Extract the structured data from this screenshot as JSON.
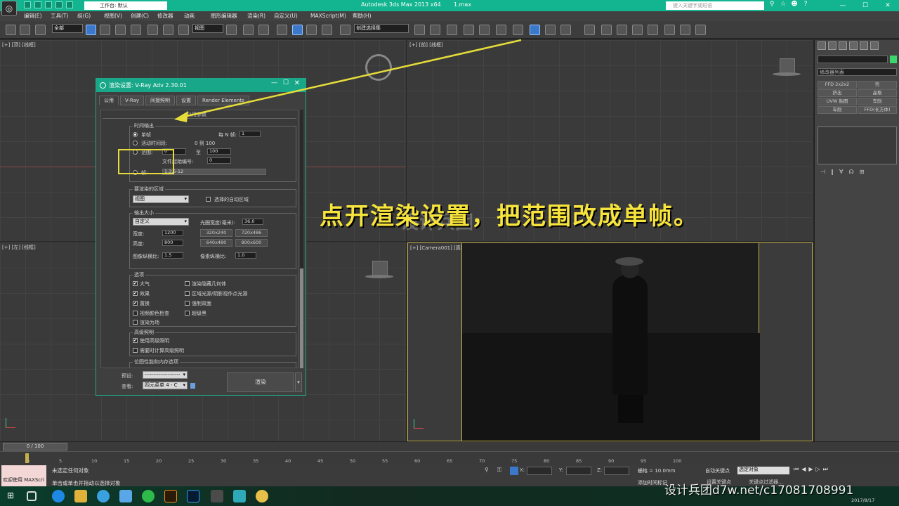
{
  "titlebar": {
    "workspace": "工作台: 默认",
    "app_title": "Autodesk 3ds Max  2013 x64",
    "file_name": "1.max",
    "search_placeholder": "键入关键字或短语",
    "minimize": "—",
    "maximize": "☐",
    "close": "✕",
    "logo": "◎"
  },
  "menu": [
    "编辑(E)",
    "工具(T)",
    "组(G)",
    "视图(V)",
    "创建(C)",
    "修改器",
    "动画",
    "图形编辑器",
    "渲染(R)",
    "自定义(U)",
    "MAXScript(M)",
    "帮助(H)"
  ],
  "toolbar": {
    "selection_filter": "全部",
    "ref_coord": "视图",
    "named_selection": "创建选择集"
  },
  "viewports": {
    "top_left_label": "[+] [顶] [线框]",
    "top_right_label": "[+] [前] [线框]",
    "bottom_left_label": "[+] [左] [线框]",
    "bottom_right_label": "[+] [Camera001] [真实]"
  },
  "overlay": {
    "instruction": "点开渲染设置，把范围改成单帧。",
    "watermark": "设计兵团"
  },
  "dialog": {
    "title": "渲染设置: V-Ray Adv 2.30.01",
    "tabs": [
      "公用",
      "V-Ray",
      "间接照明",
      "设置",
      "Render Elements"
    ],
    "rollout_title": "公用参数",
    "time_output": {
      "group_title": "时间输出",
      "single": "单帧",
      "every_nth_label": "每 N 帧:",
      "every_nth_value": "1",
      "active_segment": "活动时间段:",
      "active_range": "0 到 100",
      "range": "范围:",
      "range_from": "0",
      "range_to_label": "至",
      "range_to": "100",
      "file_start_label": "文件起始编号:",
      "file_start_value": "0",
      "frames": "帧:",
      "frames_value": "1,3,5-12"
    },
    "render_area": {
      "group_title": "要渲染的区域",
      "area_value": "视图",
      "auto_region": "选择的自动区域"
    },
    "output_size": {
      "group_title": "输出大小",
      "preset": "自定义",
      "aperture_label": "光圈宽度(毫米):",
      "aperture_value": "36.0",
      "width_label": "宽度:",
      "width_value": "1200",
      "height_label": "高度:",
      "height_value": "800",
      "presets": [
        "320x240",
        "720x486",
        "640x480",
        "800x600"
      ],
      "image_aspect_label": "图像纵横比:",
      "image_aspect_value": "1.5",
      "pixel_aspect_label": "像素纵横比:",
      "pixel_aspect_value": "1.0"
    },
    "options": {
      "group_title": "选项",
      "items": [
        {
          "label": "大气",
          "checked": "✔"
        },
        {
          "label": "渲染隐藏几何体",
          "checked": ""
        },
        {
          "label": "效果",
          "checked": "✔"
        },
        {
          "label": "区域光源/阴影视作点光源",
          "checked": ""
        },
        {
          "label": "置换",
          "checked": "✔"
        },
        {
          "label": "强制双面",
          "checked": ""
        },
        {
          "label": "视频颜色检查",
          "checked": ""
        },
        {
          "label": "超级黑",
          "checked": ""
        },
        {
          "label": "渲染为场",
          "checked": ""
        }
      ]
    },
    "advanced_lighting": {
      "group_title": "高级照明",
      "use": "使用高级照明",
      "use_checked": "✔",
      "compute": "需要时计算高级照明",
      "compute_checked": ""
    },
    "bitmap_group_title": "位图性能和内存选项",
    "preset_label": "预设:",
    "preset_value": "--------------------",
    "view_label": "查看:",
    "view_value": "四元菜单 4 - C",
    "render_button": "渲染",
    "render_dd": "▾"
  },
  "command_panel": {
    "modifier_list": "修改器列表",
    "buttons": [
      "FFD 2x2x2",
      "壳",
      "挤出",
      "晶格",
      "UVW 贴图",
      "车削",
      "车削",
      "FFD(长方体)"
    ],
    "stack_icons": [
      "⊣",
      "‖",
      "∀",
      "☊",
      "⊞"
    ]
  },
  "timeline": {
    "slider": "0 / 100",
    "ticks": [
      "0",
      "5",
      "10",
      "15",
      "20",
      "25",
      "30",
      "35",
      "40",
      "45",
      "50",
      "55",
      "60",
      "65",
      "70",
      "75",
      "80",
      "85",
      "90",
      "95",
      "100"
    ]
  },
  "status": {
    "maxscript": "欢迎使用 MAXScri",
    "line1": "未选定任何对象",
    "line2": "单击或单击并拖动以选择对象",
    "x_label": "X:",
    "y_label": "Y:",
    "z_label": "Z:",
    "grid": "栅格 = 10.0mm",
    "add_time_tag": "添加时间标记",
    "auto_key": "自动关键点",
    "selection": "选定对象",
    "set_key": "设置关键点",
    "key_filter": "关键点过滤器..."
  },
  "taskbar": {
    "start": "⊞",
    "clock": "2017/8/17"
  },
  "bottom_watermark": "设计兵团d7w.net/c17081708991",
  "colors": {
    "accent": "#18a889",
    "highlight": "#e6dd3a",
    "instruction": "#f6e43c"
  }
}
